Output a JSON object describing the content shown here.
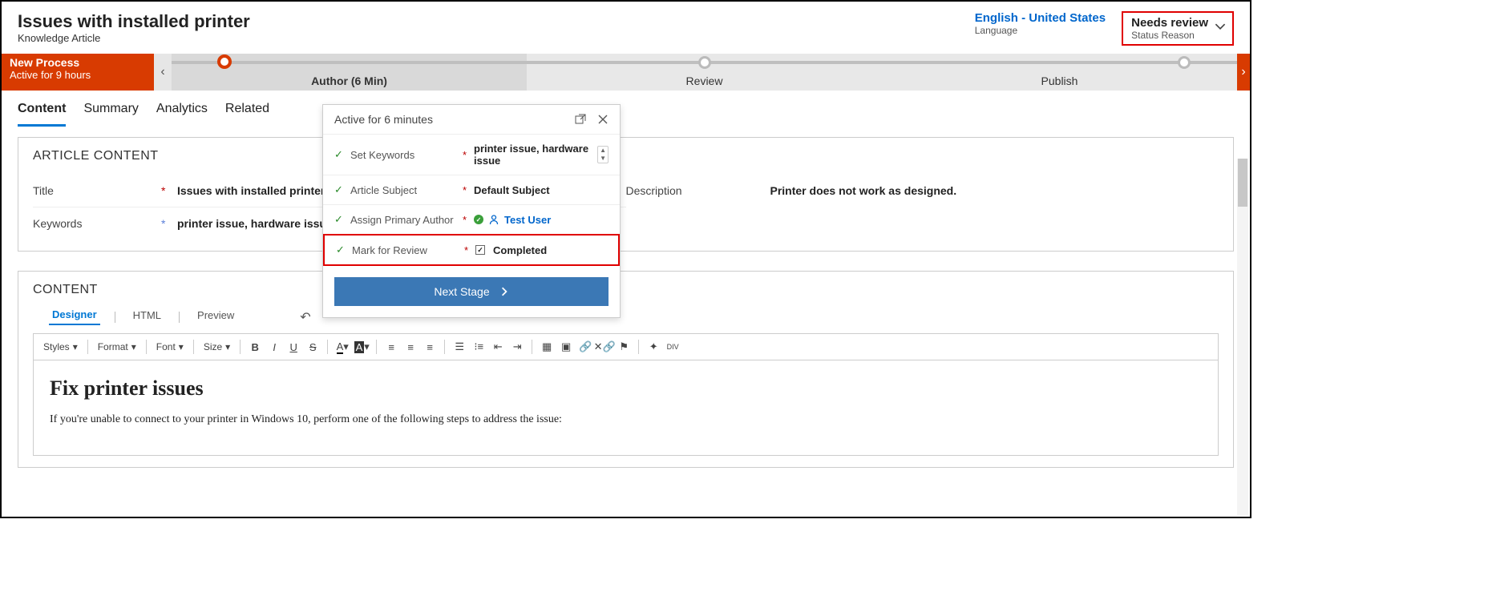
{
  "header": {
    "title": "Issues with installed printer",
    "subtitle": "Knowledge Article",
    "language": {
      "value": "English - United States",
      "label": "Language"
    },
    "status": {
      "value": "Needs review",
      "label": "Status Reason"
    }
  },
  "process": {
    "name": "New Process",
    "active_for": "Active for 9 hours",
    "stages": [
      {
        "label": "Author  (6 Min)"
      },
      {
        "label": "Review"
      },
      {
        "label": "Publish"
      }
    ]
  },
  "tabs": [
    "Content",
    "Summary",
    "Analytics",
    "Related"
  ],
  "article": {
    "section_title": "ARTICLE CONTENT",
    "title_label": "Title",
    "title_value": "Issues with installed printer",
    "keywords_label": "Keywords",
    "keywords_value": "printer issue, hardware issue",
    "description_label": "Description",
    "description_value": "Printer does not work as designed."
  },
  "content": {
    "section_title": "CONTENT",
    "sub_tabs": [
      "Designer",
      "HTML",
      "Preview"
    ],
    "toolbar": {
      "styles": "Styles",
      "format": "Format",
      "font": "Font",
      "size": "Size"
    },
    "body_heading": "Fix printer issues",
    "body_para": "If you're unable to connect to your printer in Windows 10, perform one of the following steps to address the issue:"
  },
  "popup": {
    "active_label": "Active for 6 minutes",
    "rows": {
      "keywords": {
        "label": "Set Keywords",
        "value": "printer issue, hardware issue"
      },
      "subject": {
        "label": "Article Subject",
        "value": "Default Subject"
      },
      "author": {
        "label": "Assign Primary Author",
        "value": "Test User"
      },
      "mark": {
        "label": "Mark for Review",
        "value": "Completed"
      }
    },
    "next_stage": "Next Stage"
  }
}
